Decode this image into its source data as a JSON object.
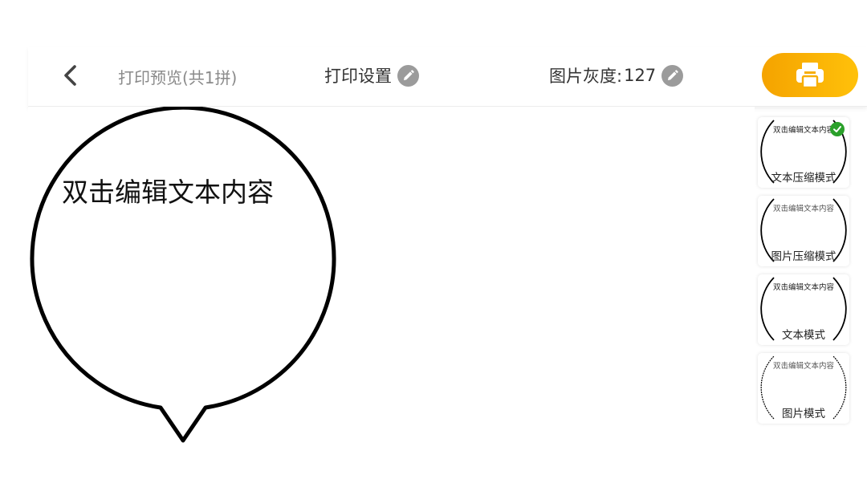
{
  "toolbar": {
    "preview_title": "打印预览(共1拼)",
    "print_settings_label": "打印设置",
    "gray_level_label": "图片灰度:",
    "gray_level_value": "127"
  },
  "canvas": {
    "bubble_text": "双击编辑文本内容"
  },
  "modes": [
    {
      "sample": "双击编辑文本内容",
      "label": "文本压缩模式",
      "selected": true
    },
    {
      "sample": "双击编辑文本内容",
      "label": "图片压缩模式",
      "selected": false
    },
    {
      "sample": "双击编辑文本内容",
      "label": "文本模式",
      "selected": false
    },
    {
      "sample": "双击编辑文本内容",
      "label": "图片模式",
      "selected": false
    }
  ],
  "colors": {
    "print_button_start": "#f5a300",
    "print_button_end": "#ffc10a",
    "check_badge": "#2aa02a",
    "edit_icon_bg": "#9b9b9b"
  },
  "icons": {
    "back": "chevron-left-icon",
    "edit": "pencil-icon",
    "print": "printer-icon",
    "selected": "check-circle-icon"
  }
}
